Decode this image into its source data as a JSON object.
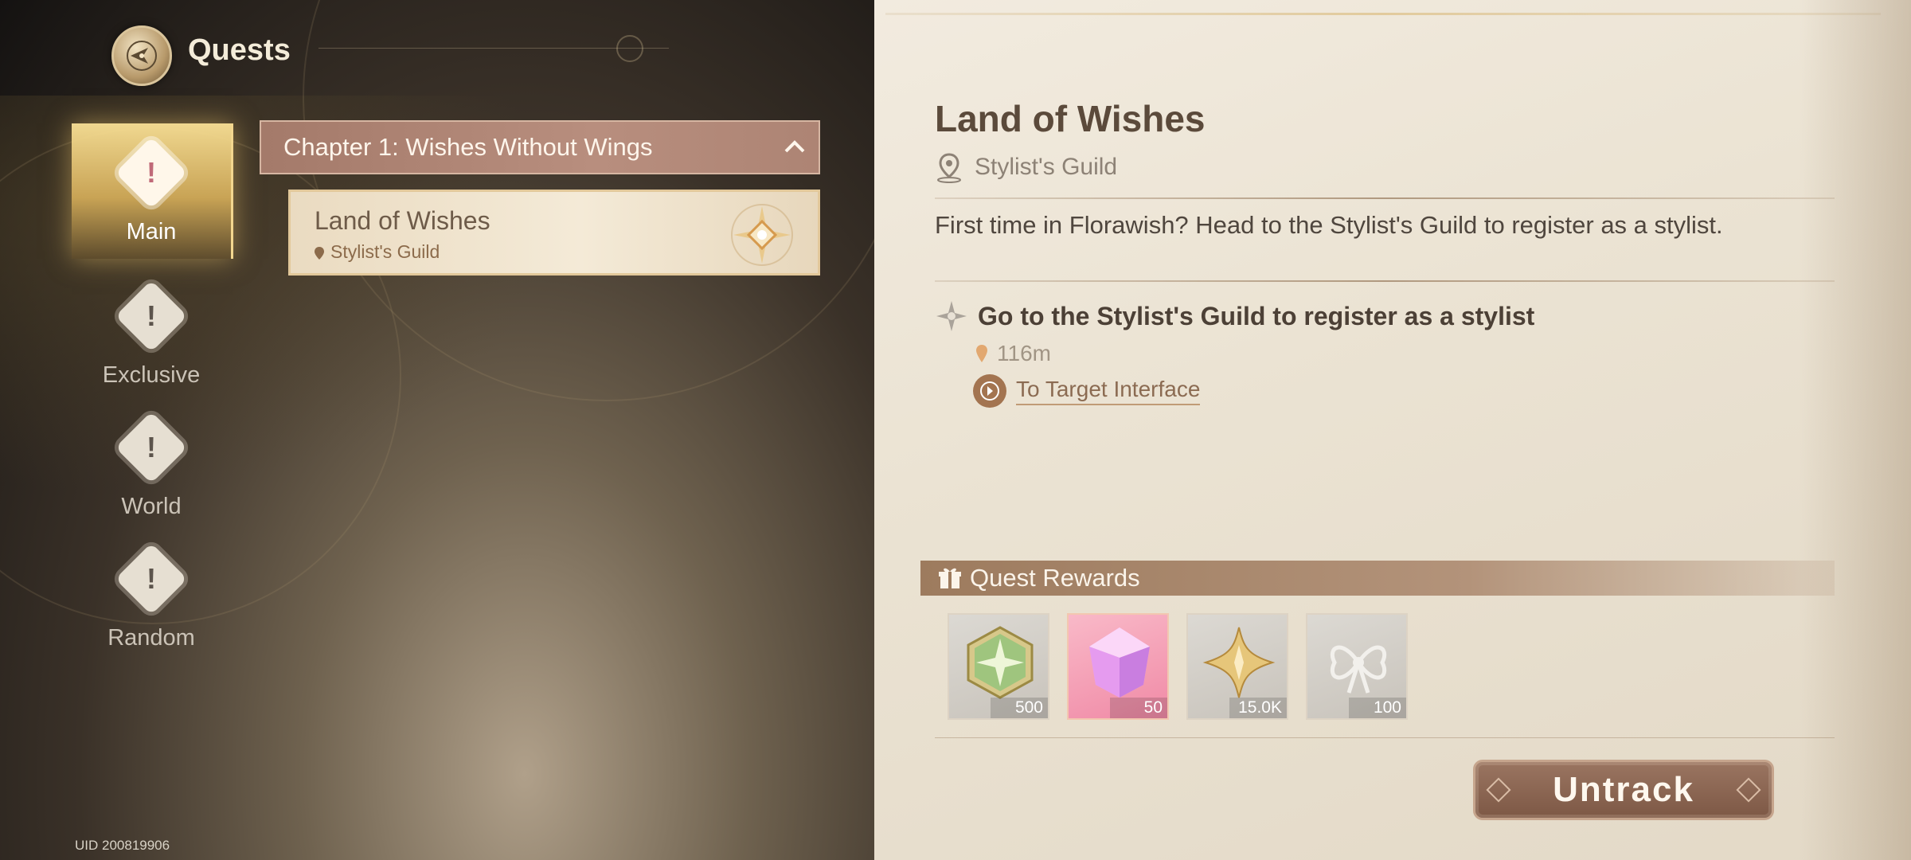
{
  "header": {
    "title": "Quests"
  },
  "nav": [
    {
      "label": "Main",
      "active": true
    },
    {
      "label": "Exclusive",
      "active": false
    },
    {
      "label": "World",
      "active": false
    },
    {
      "label": "Random",
      "active": false
    }
  ],
  "chapter": {
    "title": "Chapter 1: Wishes Without Wings"
  },
  "quest_card": {
    "title": "Land of Wishes",
    "location": "Stylist's Guild"
  },
  "uid": "UID 200819906",
  "detail": {
    "title": "Land of Wishes",
    "location": "Stylist's Guild",
    "description": "First time in Florawish? Head to the Stylist's Guild to register as a stylist.",
    "objective": "Go to the Stylist's Guild to register as a stylist",
    "distance": "116m",
    "target_link": "To Target Interface"
  },
  "rewards": {
    "title": "Quest Rewards",
    "items": [
      {
        "icon": "green-star-hexagon-icon",
        "count": "500"
      },
      {
        "icon": "pink-diamond-icon",
        "count": "50"
      },
      {
        "icon": "gold-star-icon",
        "count": "15.0K"
      },
      {
        "icon": "silver-bow-icon",
        "count": "100"
      }
    ]
  },
  "untrack_label": "Untrack",
  "colors": {
    "accent": "#a47a6a",
    "active_nav": "#e8c676",
    "panel": "#efe7d9"
  }
}
